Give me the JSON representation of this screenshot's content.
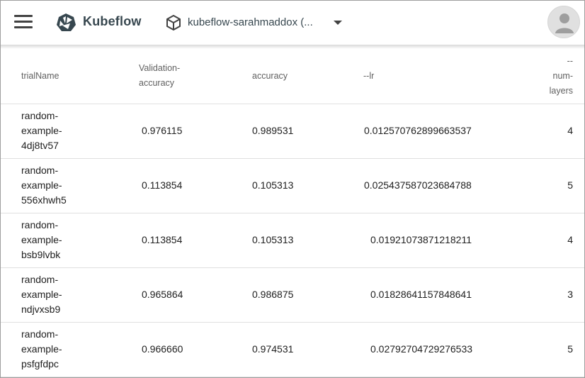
{
  "header": {
    "brand": "Kubeflow",
    "namespace": "kubeflow-sarahmaddox (...",
    "icons": {
      "menu": "hamburger-menu-icon",
      "logo": "kubeflow-logo",
      "namespace": "cube-icon",
      "dropdown": "caret-down-icon",
      "avatar": "account-circle-icon"
    }
  },
  "table": {
    "columns": {
      "trial_name": "trialName",
      "validation_accuracy": "Validation-\naccuracy",
      "accuracy": "accuracy",
      "lr": "--lr",
      "num_layers": "--\nnum-\nlayers"
    },
    "rows": [
      {
        "name": "random-\nexample-\n4dj8tv57",
        "validation_accuracy": "0.976115",
        "accuracy": "0.989531",
        "lr": "0.012570762899663537",
        "num_layers": "4"
      },
      {
        "name": "random-\nexample-\n556xhwh5",
        "validation_accuracy": "0.113854",
        "accuracy": "0.105313",
        "lr": "0.025437587023684788",
        "num_layers": "5"
      },
      {
        "name": "random-\nexample-\nbsb9lvbk",
        "validation_accuracy": "0.113854",
        "accuracy": "0.105313",
        "lr": "0.01921073871218211",
        "num_layers": "4"
      },
      {
        "name": "random-\nexample-\nndjvxsb9",
        "validation_accuracy": "0.965864",
        "accuracy": "0.986875",
        "lr": "0.01828641157848641",
        "num_layers": "3"
      },
      {
        "name": "random-\nexample-\npsfgfdpc",
        "validation_accuracy": "0.966660",
        "accuracy": "0.974531",
        "lr": "0.02792704729276533",
        "num_layers": "5"
      }
    ]
  },
  "colors": {
    "text": "#212121",
    "header_text": "#616161",
    "brand": "#37474f",
    "divider": "#e0e0e0",
    "avatar_bg": "#e0e0e0"
  }
}
